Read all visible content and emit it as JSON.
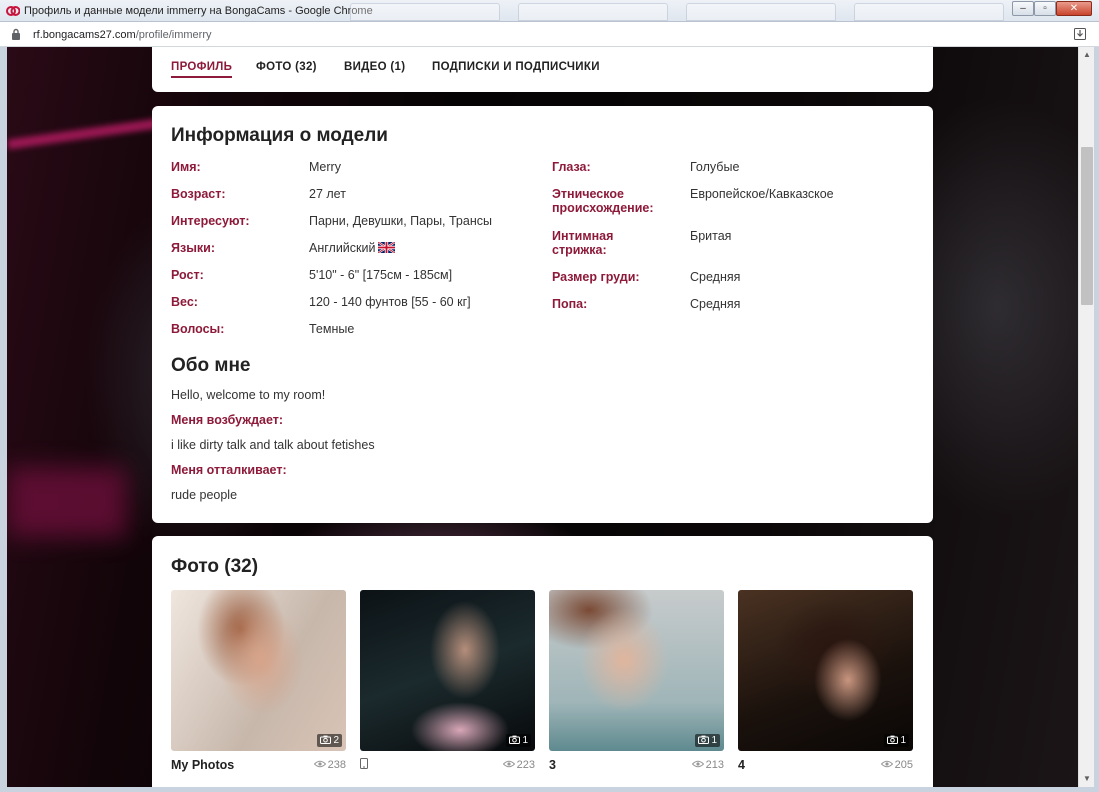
{
  "window": {
    "title": "Профиль и данные модели immerry на BongaCams - Google Chrome",
    "minimize": "–",
    "maximize": "▫",
    "close": "✕"
  },
  "address": {
    "host": "rf.bongacams27.com",
    "path": "/profile/immerry"
  },
  "tabs": [
    {
      "label": "ПРОФИЛЬ",
      "active": true
    },
    {
      "label": "ФОТО (32)",
      "active": false
    },
    {
      "label": "ВИДЕО (1)",
      "active": false
    },
    {
      "label": "ПОДПИСКИ И ПОДПИСЧИКИ",
      "active": false
    }
  ],
  "info": {
    "heading": "Информация о модели",
    "left": [
      {
        "label": "Имя:",
        "value": "Merry"
      },
      {
        "label": "Возраст:",
        "value": "27 лет"
      },
      {
        "label": "Интересуют:",
        "value": "Парни, Девушки, Пары, Трансы"
      },
      {
        "label": "Языки:",
        "value": "Английский"
      },
      {
        "label": "Рост:",
        "value": "5'10\" - 6\" [175см - 185см]"
      },
      {
        "label": "Вес:",
        "value": "120 - 140 фунтов [55 - 60 кг]"
      },
      {
        "label": "Волосы:",
        "value": "Темные"
      }
    ],
    "right": [
      {
        "label": "Глаза:",
        "value": "Голубые"
      },
      {
        "label": "Этническое происхождение:",
        "value": "Европейское/Кавказское"
      },
      {
        "label": "Интимная стрижка:",
        "value": "Бритая"
      },
      {
        "label": "Размер груди:",
        "value": "Средняя"
      },
      {
        "label": "Попа:",
        "value": "Средняя"
      }
    ]
  },
  "about": {
    "heading": "Обо мне",
    "intro": "Hello, welcome to my room!",
    "turns_on_label": "Меня возбуждает:",
    "turns_on": "i like dirty talk and talk about fetishes",
    "turns_off_label": "Меня отталкивает:",
    "turns_off": "rude people"
  },
  "photos": {
    "heading": "Фото (32)",
    "albums": [
      {
        "title": "My Photos",
        "count": "2",
        "views": "238"
      },
      {
        "title": "",
        "count": "1",
        "views": "223"
      },
      {
        "title": "3",
        "count": "1",
        "views": "213"
      },
      {
        "title": "4",
        "count": "1",
        "views": "205"
      }
    ]
  },
  "colors": {
    "accent": "#8d1a3a",
    "card_bg": "#ffffff"
  }
}
